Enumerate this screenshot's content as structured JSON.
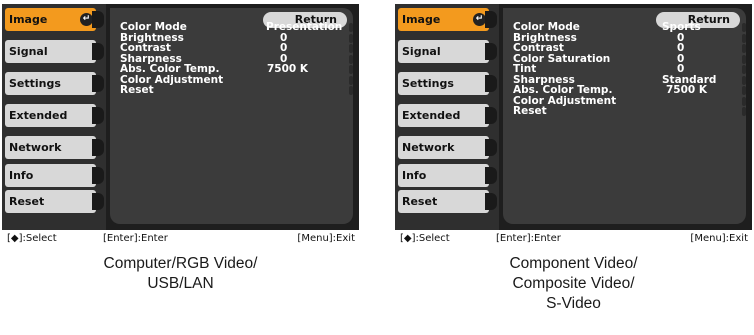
{
  "sidebar_items": [
    "Image",
    "Signal",
    "Settings",
    "Extended",
    "Network",
    "Info",
    "Reset"
  ],
  "return_label": "Return",
  "footer": {
    "select": "[◆]:Select",
    "enter": "[Enter]:Enter",
    "exit": "[Menu]:Exit"
  },
  "panels": [
    {
      "rows": [
        {
          "label": "Color Mode",
          "value": "Presentation"
        },
        {
          "label": "Brightness",
          "value": "0"
        },
        {
          "label": "Contrast",
          "value": "0"
        },
        {
          "label": "Sharpness",
          "value": "0"
        },
        {
          "label": "Abs. Color Temp.",
          "value": "7500  K"
        },
        {
          "label": "Color Adjustment",
          "value": ""
        },
        {
          "label": "Reset",
          "value": ""
        }
      ],
      "caption": [
        "Computer/RGB Video/",
        "USB/LAN"
      ]
    },
    {
      "rows": [
        {
          "label": "Color Mode",
          "value": "Sports"
        },
        {
          "label": "Brightness",
          "value": "0"
        },
        {
          "label": "Contrast",
          "value": "0"
        },
        {
          "label": "Color Saturation",
          "value": "0"
        },
        {
          "label": "Tint",
          "value": "0"
        },
        {
          "label": "Sharpness",
          "value": "Standard"
        },
        {
          "label": "Abs. Color Temp.",
          "value": "7500  K"
        },
        {
          "label": "Color Adjustment",
          "value": ""
        },
        {
          "label": "Reset",
          "value": ""
        }
      ],
      "caption": [
        "Component Video/",
        "Composite Video/",
        "S-Video"
      ]
    }
  ],
  "colors": {
    "active_tab": "#f39a1e",
    "tab": "#d8d8d8",
    "panel_bg": "#3b3b3b",
    "frame": "#1e1e1e"
  },
  "icons": {
    "enter": "enter-arrow-icon"
  }
}
